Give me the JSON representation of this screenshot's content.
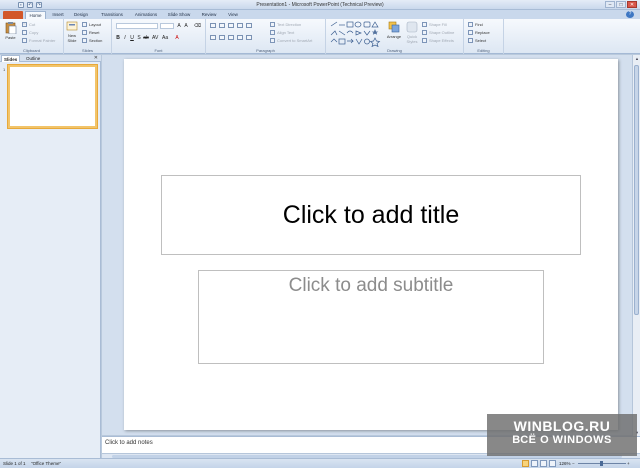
{
  "window": {
    "title": "Presentation1 - Microsoft PowerPoint (Technical Preview)",
    "minimize": "–",
    "maximize": "□",
    "close": "✕"
  },
  "tabs": {
    "file": "",
    "items": [
      "Home",
      "Insert",
      "Design",
      "Transitions",
      "Animations",
      "Slide Show",
      "Review",
      "View"
    ],
    "active": "Home",
    "help": "?"
  },
  "ribbon": {
    "clipboard": {
      "label": "Clipboard",
      "paste": "Paste",
      "cut": "Cut",
      "copy": "Copy",
      "format_painter": "Format Painter"
    },
    "slides": {
      "label": "Slides",
      "new_slide": "New Slide",
      "layout": "Layout",
      "reset": "Reset",
      "section": "Section"
    },
    "font": {
      "label": "Font"
    },
    "paragraph": {
      "label": "Paragraph",
      "text_direction": "Text Direction",
      "align_text": "Align Text",
      "convert_smartart": "Convert to SmartArt"
    },
    "drawing": {
      "label": "Drawing",
      "arrange": "Arrange",
      "quick_styles": "Quick Styles",
      "shape_fill": "Shape Fill",
      "shape_outline": "Shape Outline",
      "shape_effects": "Shape Effects"
    },
    "editing": {
      "label": "Editing",
      "find": "Find",
      "replace": "Replace",
      "select": "Select"
    }
  },
  "left_pane": {
    "tab_slides": "Slides",
    "tab_outline": "Outline",
    "close": "✕",
    "slide_number": "1"
  },
  "slide": {
    "title_placeholder": "Click to add title",
    "subtitle_placeholder": "Click to add subtitle"
  },
  "notes": {
    "placeholder": "Click to add notes"
  },
  "watermark": {
    "line1": "WINBLOG.RU",
    "line2": "ВСЁ О WINDOWS"
  },
  "status": {
    "slide_info": "Slide 1 of 1",
    "theme": "\"Office Theme\"",
    "zoom": "126%",
    "zoom_out": "−",
    "zoom_in": "+"
  }
}
